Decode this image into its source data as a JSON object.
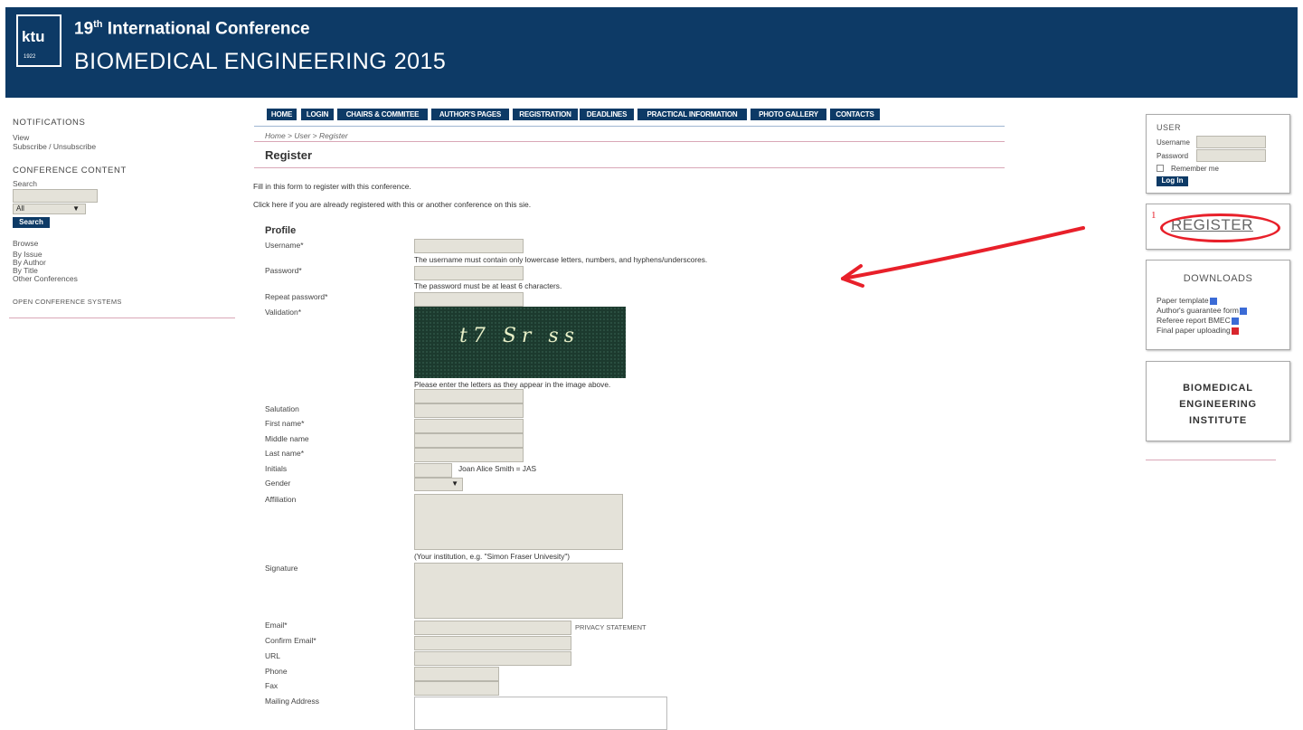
{
  "header": {
    "logo_text": "ktu",
    "logo_year": "1922",
    "line1_prefix": "19",
    "line1_sup": "th",
    "line1_rest": " International Conference",
    "line2": "BIOMEDICAL ENGINEERING 2015"
  },
  "left": {
    "notifications_title": "NOTIFICATIONS",
    "view": "View",
    "subscribe": "Subscribe / Unsubscribe",
    "content_title": "CONFERENCE CONTENT",
    "search_label": "Search",
    "search_scope": "All",
    "search_button": "Search",
    "browse": "Browse",
    "by_issue": "By Issue",
    "by_author": "By Author",
    "by_title": "By Title",
    "other_conferences": "Other Conferences",
    "ocs": "OPEN CONFERENCE SYSTEMS"
  },
  "nav": [
    "HOME",
    "LOGIN",
    "CHAIRS & COMMITEE",
    "AUTHOR'S PAGES",
    "REGISTRATION",
    "DEADLINES",
    "PRACTICAL INFORMATION",
    "PHOTO GALLERY",
    "CONTACTS"
  ],
  "breadcrumb": "Home > User > Register",
  "page_title": "Register",
  "intro": "Fill in this form to register with this conference.",
  "click_here": "Click here",
  "already_registered": " if you are already registered with this or another conference on this sie.",
  "profile_heading": "Profile",
  "form": {
    "username": "Username*",
    "username_hint": "The username must contain only lowercase letters, numbers, and hyphens/underscores.",
    "password": "Password*",
    "password_hint": "The password must be at least 6 characters.",
    "repeat_password": "Repeat password*",
    "validation": "Validation*",
    "captcha_text": "t7 Sr ss",
    "captcha_hint": "Please enter the letters as they appear in the image above.",
    "salutation": "Salutation",
    "first_name": "First name*",
    "middle_name": "Middle name",
    "last_name": "Last name*",
    "initials": "Initials",
    "initials_example": "Joan Alice Smith = JAS",
    "gender": "Gender",
    "affiliation": "Affiliation",
    "affiliation_hint": "(Your institution, e.g. \"Simon Fraser Univesity\")",
    "signature": "Signature",
    "email": "Email*",
    "privacy": "PRIVACY STATEMENT",
    "confirm_email": "Confirm Email*",
    "url": "URL",
    "phone": "Phone",
    "fax": "Fax",
    "mailing_address": "Mailing Address"
  },
  "user_box": {
    "title": "USER",
    "username": "Username",
    "password": "Password",
    "remember": "Remember me",
    "login": "Log In"
  },
  "register_box": {
    "number": "1",
    "label": "REGISTER"
  },
  "downloads": {
    "title": "DOWNLOADS",
    "items": [
      "Paper template",
      "Author's guarantee form",
      "Referee report BMEC",
      "Final paper uploading"
    ]
  },
  "institute": {
    "line1": "BIOMEDICAL",
    "line2": "ENGINEERING",
    "line3": "INSTITUTE"
  },
  "colors": {
    "header_bg": "#0d3a66",
    "annotation_red": "#e8202a"
  }
}
